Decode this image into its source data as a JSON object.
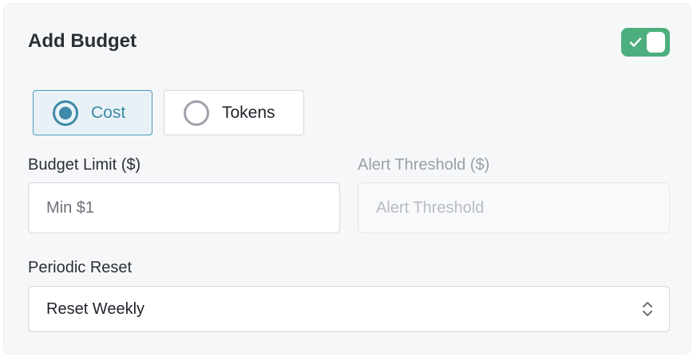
{
  "header": {
    "title": "Add Budget",
    "toggle_on": true
  },
  "budget_type": {
    "options": [
      {
        "label": "Cost",
        "selected": true
      },
      {
        "label": "Tokens",
        "selected": false
      }
    ]
  },
  "budget_limit": {
    "label": "Budget Limit ($)",
    "value": "",
    "placeholder": "Min $1"
  },
  "alert_threshold": {
    "label": "Alert Threshold ($)",
    "value": "",
    "placeholder": "Alert Threshold",
    "disabled": true
  },
  "periodic_reset": {
    "label": "Periodic Reset",
    "selected": "Reset Weekly"
  },
  "icons": {
    "toggle_check": "check-icon",
    "select_chevron": "chevron-up-down-icon"
  },
  "colors": {
    "toggle_on": "#4caf7d",
    "accent": "#3e8aa8",
    "card_bg": "#f6f7f9"
  }
}
